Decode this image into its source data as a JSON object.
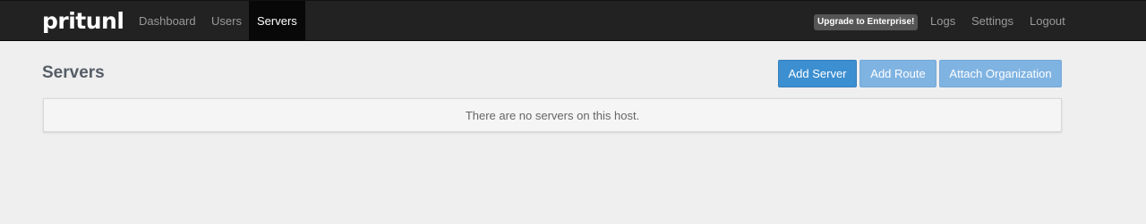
{
  "navbar": {
    "brand": "pritunl",
    "links": [
      "Dashboard",
      "Users",
      "Servers"
    ],
    "active": "Servers",
    "upgrade_badge": "Upgrade to Enterprise!",
    "right_links": [
      "Logs",
      "Settings",
      "Logout"
    ]
  },
  "page": {
    "title": "Servers",
    "buttons": {
      "add_server": "Add Server",
      "add_route": "Add Route",
      "attach_organization": "Attach Organization"
    },
    "empty_message": "There are no servers on this host."
  },
  "colors": {
    "navbar_bg": "#222222",
    "primary_button": "#3c8fd1",
    "disabled_button": "#7fb3e2",
    "page_bg": "#efefef"
  }
}
